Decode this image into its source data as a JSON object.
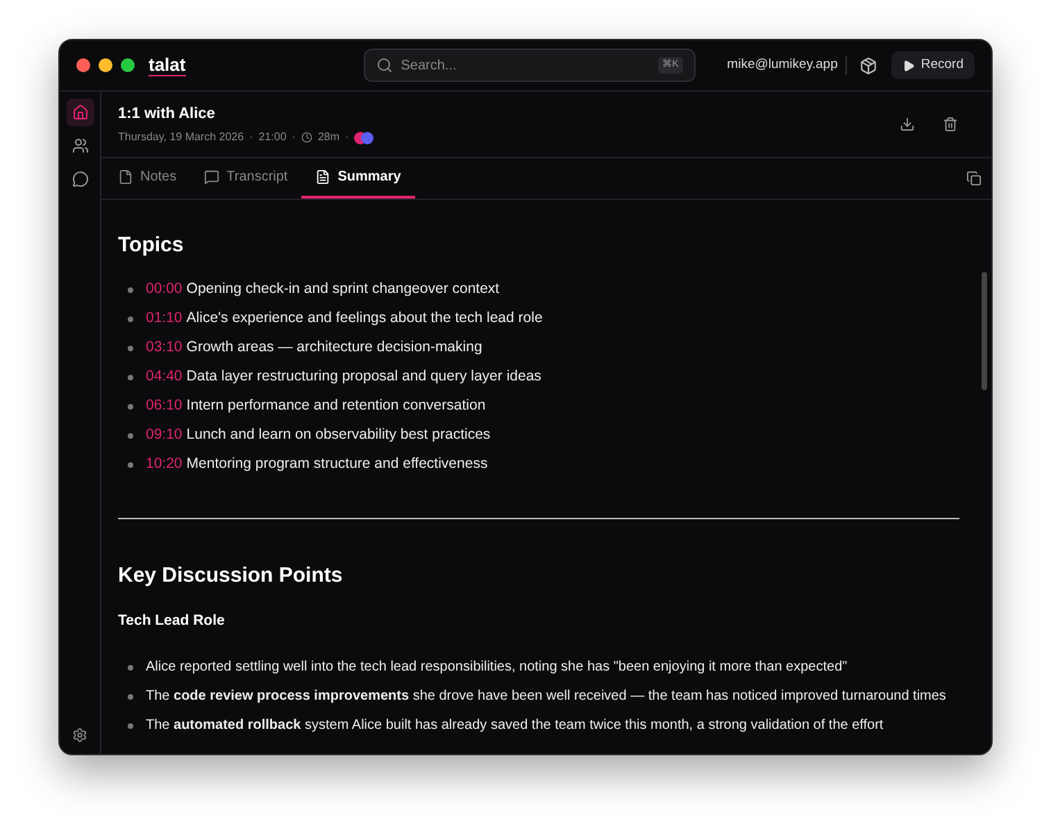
{
  "app": {
    "name": "talat"
  },
  "search": {
    "placeholder": "Search...",
    "shortcut": "⌘K"
  },
  "account": {
    "email": "mike@lumikey.app"
  },
  "record_button": {
    "label": "Record"
  },
  "sidebar": {
    "items": [
      {
        "kind": "home",
        "selected": true
      },
      {
        "kind": "people",
        "selected": false
      },
      {
        "kind": "chat",
        "selected": false
      }
    ]
  },
  "meeting": {
    "title": "1:1 with Alice",
    "date": "Thursday, 19 March 2026",
    "time": "21:00",
    "duration": "28m",
    "separators": [
      "·",
      "·",
      "·"
    ],
    "participants": [
      {
        "color": "#e0246f"
      },
      {
        "color": "#5b5ef0"
      }
    ]
  },
  "tabs": [
    {
      "kind": "notes",
      "label": "Notes",
      "selected": false
    },
    {
      "kind": "transcript",
      "label": "Transcript",
      "selected": false
    },
    {
      "kind": "summary",
      "label": "Summary",
      "selected": true
    }
  ],
  "topics": {
    "heading": "Topics",
    "items": [
      {
        "time": "00:00",
        "text": "Opening check-in and sprint changeover context"
      },
      {
        "time": "01:10",
        "text": "Alice's experience and feelings about the tech lead role"
      },
      {
        "time": "03:10",
        "text": "Growth areas — architecture decision-making"
      },
      {
        "time": "04:40",
        "text": "Data layer restructuring proposal and query layer ideas"
      },
      {
        "time": "06:10",
        "text": "Intern performance and retention conversation"
      },
      {
        "time": "09:10",
        "text": "Lunch and learn on observability best practices"
      },
      {
        "time": "10:20",
        "text": "Mentoring program structure and effectiveness"
      }
    ]
  },
  "discussion": {
    "heading": "Key Discussion Points",
    "subheading": "Tech Lead Role",
    "bullets": [
      "Alice reported settling well into the tech lead responsibilities, noting she has \"been enjoying it more than expected\"",
      "The **code review process improvements** she drove have been well received — the team has noticed improved turnaround times",
      "The **automated rollback** system Alice built has already saved the team twice this month, a strong validation of the effort"
    ]
  }
}
